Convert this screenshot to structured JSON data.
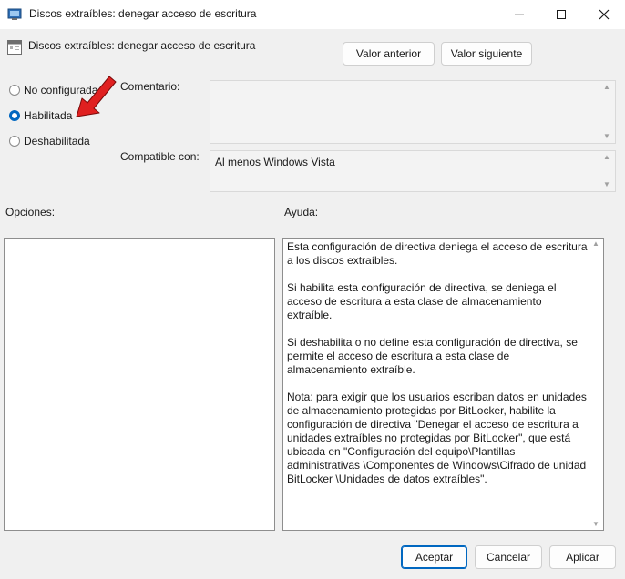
{
  "window": {
    "title": "Discos extraíbles: denegar acceso de escritura",
    "minimize_glyph": "—",
    "maximize_glyph": "☐",
    "close_glyph": "✕"
  },
  "header": {
    "policy_title": "Discos extraíbles: denegar acceso de escritura",
    "prev_button": "Valor anterior",
    "next_button": "Valor siguiente"
  },
  "state": {
    "options": [
      {
        "label": "No configurada",
        "checked": false
      },
      {
        "label": "Habilitada",
        "checked": true
      },
      {
        "label": "Deshabilitada",
        "checked": false
      }
    ]
  },
  "comment": {
    "label": "Comentario:",
    "value": ""
  },
  "compatible": {
    "label": "Compatible con:",
    "value": "Al menos Windows Vista"
  },
  "options_panel": {
    "label": "Opciones:"
  },
  "help_panel": {
    "label": "Ayuda:",
    "paragraphs": [
      "Esta configuración de directiva deniega el acceso de escritura a los discos extraíbles.",
      "Si habilita esta configuración de directiva, se deniega el acceso de escritura a esta clase de almacenamiento extraíble.",
      "Si deshabilita o no define esta configuración de directiva, se permite el acceso de escritura a esta clase de almacenamiento extraíble.",
      "Nota: para exigir que los usuarios escriban datos en unidades de almacenamiento protegidas por BitLocker, habilite la configuración de directiva \"Denegar el acceso de escritura a unidades extraíbles no protegidas por BitLocker\", que está ubicada en \"Configuración del equipo\\Plantillas administrativas \\Componentes de Windows\\Cifrado de unidad BitLocker \\Unidades de datos extraíbles\"."
    ]
  },
  "footer": {
    "accept": "Aceptar",
    "cancel": "Cancelar",
    "apply": "Aplicar"
  },
  "colors": {
    "accent": "#0067c0",
    "annotation_arrow": "#e02020"
  }
}
